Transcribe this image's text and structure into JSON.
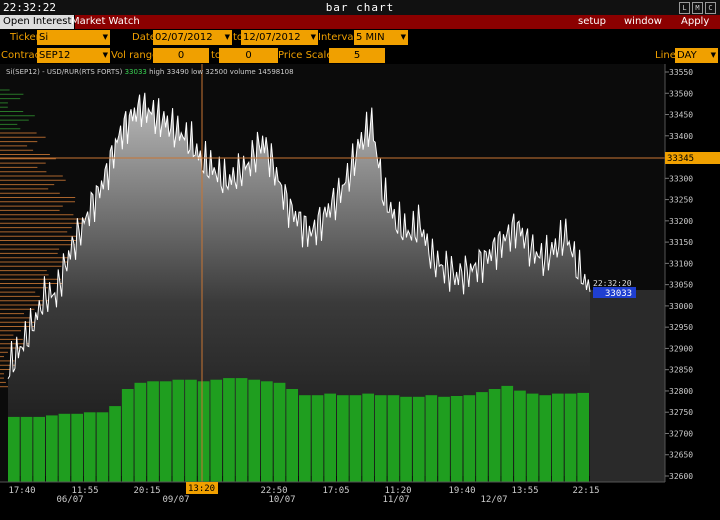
{
  "window": {
    "clock": "22:32:22",
    "title": "bar chart",
    "buttons": [
      "L",
      "M",
      "C"
    ]
  },
  "tabs": [
    {
      "label": "Open Interest",
      "active": true
    },
    {
      "label": "Market Watch",
      "active": false
    }
  ],
  "menu": {
    "setup": "setup",
    "window": "window",
    "apply": "Apply"
  },
  "form": {
    "ticker_label": "Ticker",
    "ticker_value": "Si",
    "date_label": "Date",
    "date_from": "02/07/2012",
    "to_label": "to",
    "date_to": "12/07/2012",
    "interval_label": "Interval",
    "interval_value": "5 MIN",
    "contract_label": "Contract",
    "contract_value": "SEP12",
    "volrange_label": "Vol range",
    "volrange_from": "0",
    "volrange_to_label": "to",
    "volrange_to": "0",
    "pricescale_label": "Price Scale",
    "pricescale_value": "5",
    "line_label": "Line",
    "line_value": "DAY"
  },
  "legend": {
    "instrument": "Si(SEP12) - USD/RUR(RTS FORTS)",
    "current": "33033",
    "high": "high 33490",
    "low": "low 32500",
    "volume": "volume 14598108"
  },
  "crosshair": {
    "price_label": "33345",
    "time_label": "13:20"
  },
  "last_quote": {
    "time": "22:32:20",
    "price": "33033"
  },
  "colors": {
    "accent": "#f0a000",
    "tab_bar": "#8b0000",
    "volume": "#1f9e1f",
    "price_line": "#ffffff",
    "crosshair": "#c87533",
    "quote_tag": "#1f3fd0"
  },
  "chart_data": {
    "type": "area",
    "y_axis": {
      "ticks": [
        33550,
        33500,
        33450,
        33400,
        33350,
        33300,
        33250,
        33200,
        33150,
        33100,
        33050,
        33000,
        32950,
        32900,
        32850,
        32800,
        32750,
        32700,
        32650,
        32600
      ],
      "ylim": [
        32600,
        33550
      ]
    },
    "x_axis": {
      "time_ticks": [
        "17:40",
        "11:55",
        "20:15",
        "13:20",
        "22:50",
        "17:05",
        "11:20",
        "19:40",
        "13:55",
        "22:15"
      ],
      "date_ticks": [
        "06/07",
        "09/07",
        "10/07",
        "11/07",
        "12/07"
      ]
    },
    "series": [
      {
        "values": [
          32850,
          32900,
          32950,
          33020,
          33030,
          33120,
          33180,
          33240,
          33300,
          33390,
          33440,
          33470,
          33450,
          33430,
          33410,
          33390,
          33340,
          33320,
          33290,
          33310,
          33340,
          33390,
          33320,
          33240,
          33200,
          33170,
          33210,
          33250,
          33300,
          33380,
          33430,
          33260,
          33200,
          33170,
          33190,
          33110,
          33090,
          33070,
          33080,
          33100,
          33130,
          33160,
          33190,
          33140,
          33110,
          33130,
          33170,
          33090,
          33033
        ]
      }
    ],
    "volume": [
      420,
      420,
      420,
      430,
      440,
      440,
      450,
      450,
      490,
      600,
      640,
      650,
      650,
      660,
      660,
      650,
      660,
      670,
      670,
      660,
      650,
      640,
      600,
      560,
      560,
      570,
      560,
      560,
      570,
      560,
      560,
      550,
      550,
      560,
      550,
      555,
      560,
      580,
      600,
      620,
      590,
      570,
      560,
      570,
      570,
      575
    ]
  }
}
